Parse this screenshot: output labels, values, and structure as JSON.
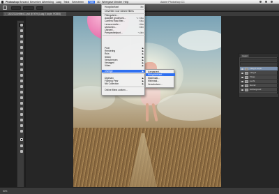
{
  "menubar": {
    "app": "Photoshop",
    "items": [
      "Bestand",
      "Bewerken",
      "Afbeelding",
      "Laag",
      "Tekst",
      "Selecteren",
      "Filter",
      "3D",
      "Weergave",
      "Venster",
      "Help"
    ],
    "active": "Filter",
    "window_title": "Adobe Photoshop CC"
  },
  "filter_menu": {
    "items": [
      {
        "label": "Hoogdoorlaat",
        "shortcut": "⌘F"
      },
      {
        "label": "Omzetten voor slimme filters",
        "shortcut": ""
      },
      {
        "label": "Filtergalerie...",
        "shortcut": ""
      },
      {
        "label": "Adaptief groothoek...",
        "shortcut": "⌥⇧⌘A"
      },
      {
        "label": "Camera Raw-filter...",
        "shortcut": "⇧⌘A"
      },
      {
        "label": "Lenscorrectie...",
        "shortcut": "⇧⌘R"
      },
      {
        "label": "Uitvloeien...",
        "shortcut": "⇧⌘X"
      },
      {
        "label": "Olieverf...",
        "shortcut": ""
      },
      {
        "label": "Perspectiefpunt...",
        "shortcut": "⌥⌘V"
      },
      {
        "label": "Pixel",
        "submenu": true
      },
      {
        "label": "Rendering",
        "submenu": true
      },
      {
        "label": "Ruis",
        "submenu": true
      },
      {
        "label": "Stileer",
        "submenu": true
      },
      {
        "label": "Verscherpen",
        "submenu": true
      },
      {
        "label": "Vervagen",
        "submenu": true
      },
      {
        "label": "Video",
        "submenu": true
      },
      {
        "label": "Overige",
        "submenu": true
      },
      {
        "label": "Digimarc",
        "submenu": true
      },
      {
        "label": "Flaming Pear",
        "submenu": true
      },
      {
        "label": "Nik Collection",
        "submenu": true
      },
      {
        "label": "Online filters zoeken...",
        "shortcut": ""
      }
    ],
    "highlighted": "Overige"
  },
  "submenu": {
    "items": [
      "Aangepast...",
      "Hoogdoorlaat...",
      "Maximaal...",
      "Minimaal...",
      "Verschuiven..."
    ],
    "highlighted": "Hoogdoorlaat..."
  },
  "document": {
    "tab_title": "1410211Untitled-1.psd @ 50% (Laag 0 kopie, RGB/8)"
  },
  "layers_panel": {
    "tab": "Lagen",
    "layers": [
      "Laag 0 kopie",
      "Laag 0",
      "Vinge",
      "Lucht",
      "Grond",
      "Achtergrond"
    ],
    "selected_index": 0
  },
  "status": {
    "zoom": "50%"
  }
}
